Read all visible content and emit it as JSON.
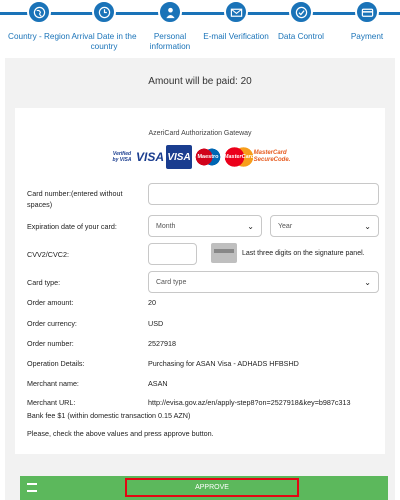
{
  "steps": [
    {
      "label": "Country - Region",
      "icon": "globe-icon"
    },
    {
      "label": "Arrival Date in the country",
      "icon": "calendar-clock-icon"
    },
    {
      "label": "Personal information",
      "icon": "person-icon"
    },
    {
      "label": "E-mail Verification",
      "icon": "envelope-icon"
    },
    {
      "label": "Data Control",
      "icon": "checkmark-icon"
    },
    {
      "label": "Payment",
      "icon": "credit-card-icon"
    }
  ],
  "amount_text": "Amount will be paid: 20",
  "gateway": {
    "title": "AzeriCard Authorization Gateway",
    "logos": {
      "vbv": "Verified by VISA",
      "visa": "VISA",
      "visa_electron": "VISA",
      "maestro": "Maestro",
      "mastercard": "MasterCard",
      "mc_securecode": "MasterCard SecureCode."
    }
  },
  "form": {
    "card_number_label": "Card number:(entered without spaces)",
    "expiration_label": "Expiration date of your card:",
    "month_placeholder": "Month",
    "year_placeholder": "Year",
    "cvv_label": "CVV2/CVC2:",
    "cvv_hint": "Last three digits on the signature panel.",
    "card_type_label": "Card type:",
    "card_type_placeholder": "Card type"
  },
  "details": [
    {
      "label": "Order amount:",
      "value": "20"
    },
    {
      "label": "Order currency:",
      "value": "USD"
    },
    {
      "label": "Order number:",
      "value": "2527918"
    },
    {
      "label": "Operation Details:",
      "value": "Purchasing for ASAN Visa - ADHADS HFBSHD"
    },
    {
      "label": "Merchant name:",
      "value": "ASAN"
    },
    {
      "label": "Merchant URL:",
      "value": "http://evisa.gov.az/en/apply-step8?on=2527918&key=b987c313"
    }
  ],
  "bank_fee": "Bank fee $1 (within domestic transaction 0.15 AZN)",
  "check_notice": "Please, check the above values and press approve button.",
  "approve_label": "APPROVE",
  "colors": {
    "step_blue": "#1a73b8",
    "approve_green": "#5cb85c",
    "highlight_red": "#e30613"
  }
}
